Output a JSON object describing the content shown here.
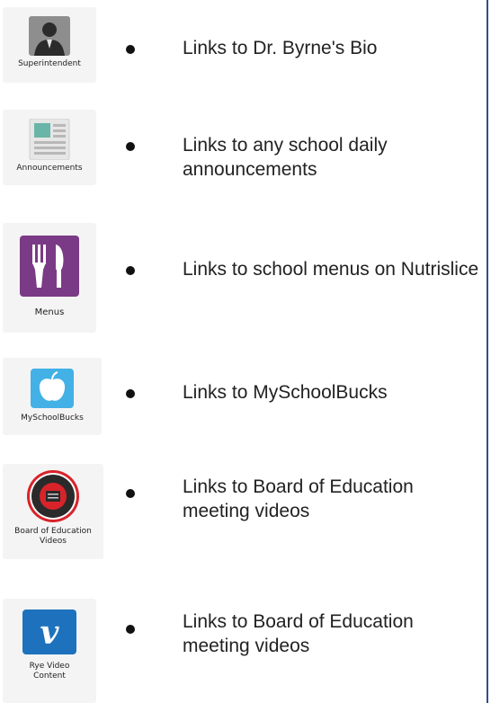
{
  "items": [
    {
      "caption": "Superintendent",
      "icon": "superintendent-avatar-icon",
      "description": "Links to Dr. Byrne's Bio"
    },
    {
      "caption": "Announcements",
      "icon": "newspaper-icon",
      "description": "Links to any school daily announcements"
    },
    {
      "caption": "Menus",
      "icon": "fork-knife-icon",
      "description": "Links to school menus on Nutrislice"
    },
    {
      "caption": "MySchoolBucks",
      "icon": "apple-icon",
      "description": "Links to MySchoolBucks"
    },
    {
      "caption": "Board of Education Videos",
      "icon": "district-seal-icon",
      "description": "Links to Board of Education meeting videos"
    },
    {
      "caption": "Rye Video Content",
      "icon": "vimeo-icon",
      "description": "Links to Board of Education meeting videos"
    }
  ],
  "colors": {
    "border": "#2f4f8f",
    "menus_tile": "#7b3a86",
    "apple_tile": "#43b1e6",
    "vimeo_tile": "#1e72bd",
    "seal_red": "#d8232a"
  }
}
